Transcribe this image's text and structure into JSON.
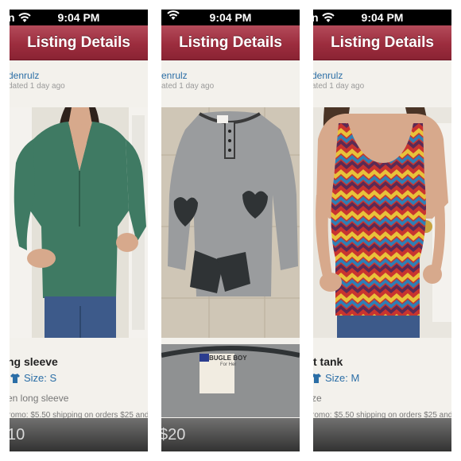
{
  "screens": [
    {
      "status": {
        "carrier_fragment": "n",
        "time": "9:04 PM"
      },
      "nav_title": "Listing Details",
      "seller": "denrulz",
      "updated": "dated 1 day ago",
      "title": "ng sleeve",
      "size_label": "Size: S",
      "description": "en long sleeve",
      "promo": "romo: $5.50 shipping on orders $25 and",
      "price": "10"
    },
    {
      "status": {
        "carrier_fragment": "",
        "time": "9:04 PM"
      },
      "nav_title": "Listing Details",
      "seller": "enrulz",
      "updated": "ated 1 day ago",
      "tag": {
        "brand": "BUGLE BOY",
        "line": "For Her"
      },
      "price": "$20"
    },
    {
      "status": {
        "carrier_fragment": "n",
        "time": "9:04 PM"
      },
      "nav_title": "Listing Details",
      "seller": "denrulz",
      "updated": "ated 1 day ago",
      "title": "t tank",
      "size_label": "Size: M",
      "description": "ze",
      "promo": "romo: $5.50 shipping on orders $25 and",
      "price": ""
    }
  ],
  "colors": {
    "navbar": "#9c2d3e",
    "link": "#2b6ea6",
    "background": "#f3f1ec"
  }
}
